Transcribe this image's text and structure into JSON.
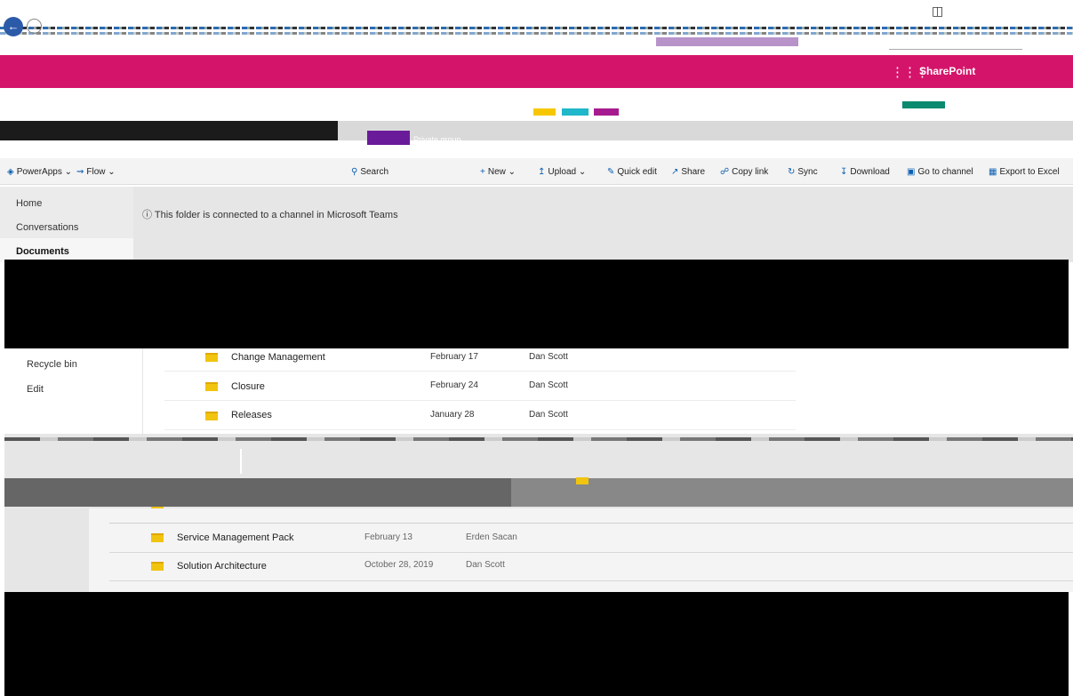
{
  "suite": {
    "brand": "SharePoint"
  },
  "site": {
    "name": "Private group"
  },
  "commands": [
    {
      "label": "PowerApps",
      "icon": "powerapps-icon"
    },
    {
      "label": "Flow",
      "icon": "flow-icon"
    },
    {
      "label": "Search",
      "icon": "search-icon"
    },
    {
      "label": "New",
      "icon": "plus-icon"
    },
    {
      "label": "Upload",
      "icon": "upload-icon"
    },
    {
      "label": "Quick edit",
      "icon": "pencil-icon"
    },
    {
      "label": "Share",
      "icon": "share-icon"
    },
    {
      "label": "Copy link",
      "icon": "link-icon"
    },
    {
      "label": "Sync",
      "icon": "sync-icon"
    },
    {
      "label": "Download",
      "icon": "download-icon"
    },
    {
      "label": "Go to channel",
      "icon": "teams-icon"
    },
    {
      "label": "Export to Excel",
      "icon": "excel-icon"
    }
  ],
  "nav": {
    "home": "Home",
    "conversations": "Conversations",
    "documents": "Documents",
    "recycle_bin": "Recycle bin",
    "edit": "Edit"
  },
  "notice": "ⓘ This folder is connected to a channel in Microsoft Teams",
  "files": [
    {
      "name": "Change Management",
      "modified": "February 17",
      "by": "Dan Scott"
    },
    {
      "name": "Closure",
      "modified": "February 24",
      "by": "Dan Scott"
    },
    {
      "name": "Releases",
      "modified": "January 28",
      "by": "Dan Scott"
    }
  ],
  "lower_files": [
    {
      "name": "Service Management Pack",
      "modified": "February 13",
      "by": "Erden Sacan"
    },
    {
      "name": "Solution Architecture",
      "modified": "October 28, 2019",
      "by": "Dan Scott"
    }
  ]
}
